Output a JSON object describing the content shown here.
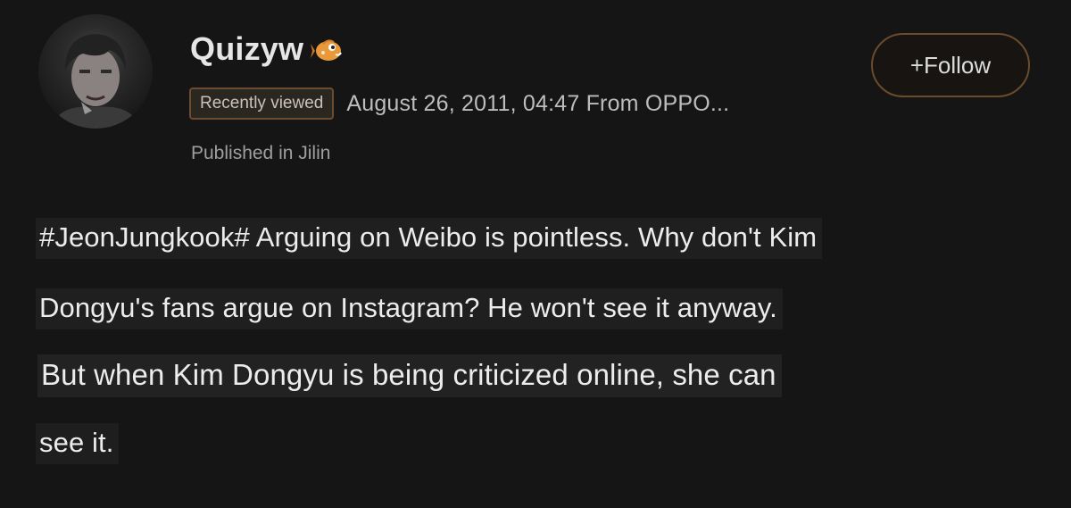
{
  "post": {
    "username": "Quizyw",
    "badge_icon": "fish-badge-icon",
    "follow_label": "+Follow",
    "recently_viewed": "Recently viewed",
    "timestamp": "August 26, 2011, 04:47 From OPPO...",
    "location": "Published in Jilin",
    "body_lines": [
      "#JeonJungkook# Arguing on Weibo is pointless. Why don't Kim",
      "Dongyu's fans argue on Instagram? He won't see it anyway.",
      "But when Kim Dongyu is being criticized online, she can",
      "see it."
    ]
  },
  "colors": {
    "background": "#151515",
    "accent_border": "#6a4b2c",
    "text": "#e9e9e9"
  }
}
